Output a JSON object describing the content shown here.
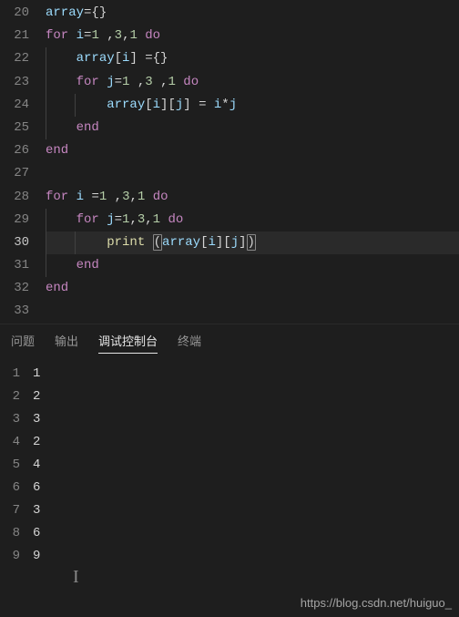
{
  "editor": {
    "lines": [
      {
        "n": 20,
        "indent": 0,
        "tokens": [
          [
            "id",
            "array"
          ],
          [
            "op",
            "="
          ],
          [
            "brace",
            "{}"
          ]
        ]
      },
      {
        "n": 21,
        "indent": 0,
        "tokens": [
          [
            "kw",
            "for"
          ],
          [
            "punc",
            " "
          ],
          [
            "id",
            "i"
          ],
          [
            "op",
            "="
          ],
          [
            "num",
            "1"
          ],
          [
            "punc",
            " ,"
          ],
          [
            "num",
            "3"
          ],
          [
            "punc",
            ","
          ],
          [
            "num",
            "1"
          ],
          [
            "punc",
            " "
          ],
          [
            "kw",
            "do"
          ]
        ]
      },
      {
        "n": 22,
        "indent": 1,
        "tokens": [
          [
            "id",
            "array"
          ],
          [
            "punc",
            "["
          ],
          [
            "id",
            "i"
          ],
          [
            "punc",
            "]"
          ],
          [
            "punc",
            " "
          ],
          [
            "op",
            "="
          ],
          [
            "brace",
            "{}"
          ]
        ]
      },
      {
        "n": 23,
        "indent": 1,
        "tokens": [
          [
            "kw",
            "for"
          ],
          [
            "punc",
            " "
          ],
          [
            "id",
            "j"
          ],
          [
            "op",
            "="
          ],
          [
            "num",
            "1"
          ],
          [
            "punc",
            " ,"
          ],
          [
            "num",
            "3"
          ],
          [
            "punc",
            " ,"
          ],
          [
            "num",
            "1"
          ],
          [
            "punc",
            " "
          ],
          [
            "kw",
            "do"
          ]
        ]
      },
      {
        "n": 24,
        "indent": 2,
        "tokens": [
          [
            "id",
            "array"
          ],
          [
            "punc",
            "["
          ],
          [
            "id",
            "i"
          ],
          [
            "punc",
            "]["
          ],
          [
            "id",
            "j"
          ],
          [
            "punc",
            "]"
          ],
          [
            "punc",
            " "
          ],
          [
            "op",
            "="
          ],
          [
            "punc",
            " "
          ],
          [
            "id",
            "i"
          ],
          [
            "op",
            "*"
          ],
          [
            "id",
            "j"
          ]
        ]
      },
      {
        "n": 25,
        "indent": 1,
        "tokens": [
          [
            "kw",
            "end"
          ]
        ]
      },
      {
        "n": 26,
        "indent": 0,
        "tokens": [
          [
            "kw",
            "end"
          ]
        ]
      },
      {
        "n": 27,
        "indent": 0,
        "tokens": []
      },
      {
        "n": 28,
        "indent": 0,
        "tokens": [
          [
            "kw",
            "for"
          ],
          [
            "punc",
            " "
          ],
          [
            "id",
            "i"
          ],
          [
            "punc",
            " "
          ],
          [
            "op",
            "="
          ],
          [
            "num",
            "1"
          ],
          [
            "punc",
            " ,"
          ],
          [
            "num",
            "3"
          ],
          [
            "punc",
            ","
          ],
          [
            "num",
            "1"
          ],
          [
            "punc",
            " "
          ],
          [
            "kw",
            "do"
          ]
        ]
      },
      {
        "n": 29,
        "indent": 1,
        "tokens": [
          [
            "kw",
            "for"
          ],
          [
            "punc",
            " "
          ],
          [
            "id",
            "j"
          ],
          [
            "op",
            "="
          ],
          [
            "num",
            "1"
          ],
          [
            "punc",
            ","
          ],
          [
            "num",
            "3"
          ],
          [
            "punc",
            ","
          ],
          [
            "num",
            "1"
          ],
          [
            "punc",
            " "
          ],
          [
            "kw",
            "do"
          ]
        ]
      },
      {
        "n": 30,
        "indent": 2,
        "current": true,
        "tokens": [
          [
            "fn",
            "print"
          ],
          [
            "punc",
            " "
          ],
          [
            "punchl",
            "("
          ],
          [
            "id",
            "array"
          ],
          [
            "punc",
            "["
          ],
          [
            "id",
            "i"
          ],
          [
            "punc",
            "]["
          ],
          [
            "id",
            "j"
          ],
          [
            "punc",
            "]"
          ],
          [
            "punchl",
            ")"
          ]
        ]
      },
      {
        "n": 31,
        "indent": 1,
        "tokens": [
          [
            "kw",
            "end"
          ]
        ]
      },
      {
        "n": 32,
        "indent": 0,
        "tokens": [
          [
            "kw",
            "end"
          ]
        ]
      },
      {
        "n": 33,
        "indent": 0,
        "tokens": []
      }
    ],
    "baseIndentCols": 1,
    "indentCols": 4
  },
  "panel": {
    "tabs": [
      {
        "id": "problems",
        "label": "问题",
        "active": false
      },
      {
        "id": "output",
        "label": "输出",
        "active": false
      },
      {
        "id": "debug-console",
        "label": "调试控制台",
        "active": true
      },
      {
        "id": "terminal",
        "label": "终端",
        "active": false
      }
    ]
  },
  "console": {
    "lines": [
      "1",
      "2",
      "3",
      "2",
      "4",
      "6",
      "3",
      "6",
      "9"
    ]
  },
  "watermark": "https://blog.csdn.net/huiguo_"
}
